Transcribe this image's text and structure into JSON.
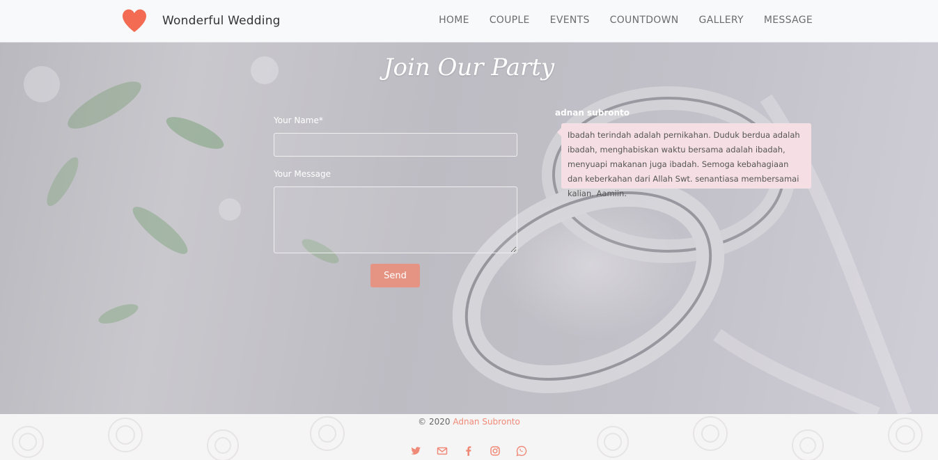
{
  "brand": {
    "name": "Wonderful Wedding",
    "icon": "heart-icon",
    "accent": "#f26b52"
  },
  "nav": {
    "items": [
      "HOME",
      "COUPLE",
      "EVENTS",
      "COUNTDOWN",
      "GALLERY",
      "MESSAGE"
    ]
  },
  "section": {
    "title": "Join Our Party"
  },
  "form": {
    "name_label": "Your Name*",
    "name_value": "",
    "message_label": "Your Message",
    "message_value": "",
    "send_label": "Send",
    "send_color": "#e59484"
  },
  "comment": {
    "author": "adnan subronto",
    "text": "Ibadah terindah adalah pernikahan. Duduk berdua adalah ibadah, menghabiskan waktu bersama adalah ibadah, menyuapi makanan juga ibadah. Semoga kebahagiaan dan keberkahan dari Allah Swt. senantiasa membersamai kalian. Aamiin.",
    "bubble_color": "#f5dfe4"
  },
  "footer": {
    "copyright_prefix": "© 2020",
    "copyright_author": "Adnan Subronto",
    "author_color": "#f08a78",
    "socials": [
      "twitter-icon",
      "envelope-icon",
      "facebook-icon",
      "instagram-icon",
      "whatsapp-icon"
    ],
    "social_color": "#f08a78"
  }
}
